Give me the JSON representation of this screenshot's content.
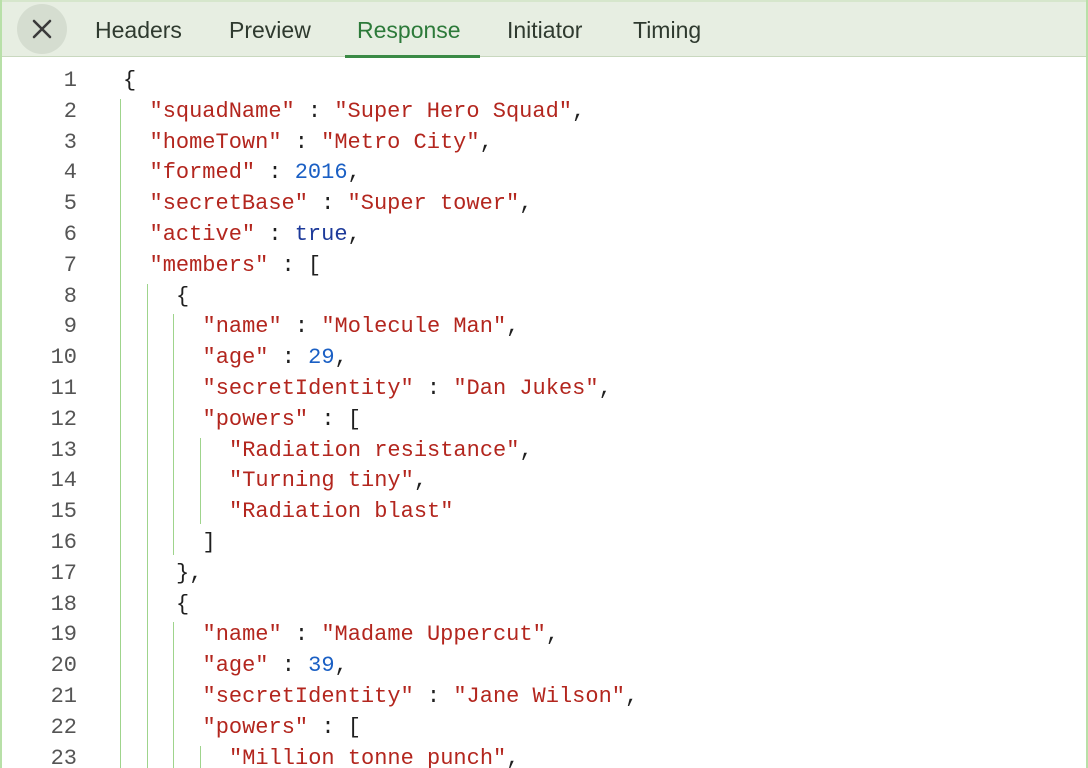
{
  "tabs": {
    "close_icon": "close-icon",
    "items": [
      {
        "label": "Headers",
        "active": false
      },
      {
        "label": "Preview",
        "active": false
      },
      {
        "label": "Response",
        "active": true
      },
      {
        "label": "Initiator",
        "active": false
      },
      {
        "label": "Timing",
        "active": false
      }
    ]
  },
  "colors": {
    "accent": "#3a8a45",
    "string": "#b3261e",
    "number": "#1a5fc4",
    "keyword": "#1d3a9a",
    "guide": "#9fd48c"
  },
  "response": {
    "lines": [
      {
        "n": "1",
        "indent": 0,
        "tokens": [
          [
            "p",
            "{"
          ]
        ]
      },
      {
        "n": "2",
        "indent": 1,
        "tokens": [
          [
            "s",
            "\"squadName\""
          ],
          [
            "p",
            " : "
          ],
          [
            "s",
            "\"Super Hero Squad\""
          ],
          [
            "p",
            ","
          ]
        ]
      },
      {
        "n": "3",
        "indent": 1,
        "tokens": [
          [
            "s",
            "\"homeTown\""
          ],
          [
            "p",
            " : "
          ],
          [
            "s",
            "\"Metro City\""
          ],
          [
            "p",
            ","
          ]
        ]
      },
      {
        "n": "4",
        "indent": 1,
        "tokens": [
          [
            "s",
            "\"formed\""
          ],
          [
            "p",
            " : "
          ],
          [
            "n",
            "2016"
          ],
          [
            "p",
            ","
          ]
        ]
      },
      {
        "n": "5",
        "indent": 1,
        "tokens": [
          [
            "s",
            "\"secretBase\""
          ],
          [
            "p",
            " : "
          ],
          [
            "s",
            "\"Super tower\""
          ],
          [
            "p",
            ","
          ]
        ]
      },
      {
        "n": "6",
        "indent": 1,
        "tokens": [
          [
            "s",
            "\"active\""
          ],
          [
            "p",
            " : "
          ],
          [
            "k",
            "true"
          ],
          [
            "p",
            ","
          ]
        ]
      },
      {
        "n": "7",
        "indent": 1,
        "tokens": [
          [
            "s",
            "\"members\""
          ],
          [
            "p",
            " : ["
          ]
        ]
      },
      {
        "n": "8",
        "indent": 2,
        "tokens": [
          [
            "p",
            "{"
          ]
        ]
      },
      {
        "n": "9",
        "indent": 3,
        "tokens": [
          [
            "s",
            "\"name\""
          ],
          [
            "p",
            " : "
          ],
          [
            "s",
            "\"Molecule Man\""
          ],
          [
            "p",
            ","
          ]
        ]
      },
      {
        "n": "10",
        "indent": 3,
        "tokens": [
          [
            "s",
            "\"age\""
          ],
          [
            "p",
            " : "
          ],
          [
            "n",
            "29"
          ],
          [
            "p",
            ","
          ]
        ]
      },
      {
        "n": "11",
        "indent": 3,
        "tokens": [
          [
            "s",
            "\"secretIdentity\""
          ],
          [
            "p",
            " : "
          ],
          [
            "s",
            "\"Dan Jukes\""
          ],
          [
            "p",
            ","
          ]
        ]
      },
      {
        "n": "12",
        "indent": 3,
        "tokens": [
          [
            "s",
            "\"powers\""
          ],
          [
            "p",
            " : ["
          ]
        ]
      },
      {
        "n": "13",
        "indent": 4,
        "tokens": [
          [
            "s",
            "\"Radiation resistance\""
          ],
          [
            "p",
            ","
          ]
        ]
      },
      {
        "n": "14",
        "indent": 4,
        "tokens": [
          [
            "s",
            "\"Turning tiny\""
          ],
          [
            "p",
            ","
          ]
        ]
      },
      {
        "n": "15",
        "indent": 4,
        "tokens": [
          [
            "s",
            "\"Radiation blast\""
          ]
        ]
      },
      {
        "n": "16",
        "indent": 3,
        "tokens": [
          [
            "p",
            "]"
          ]
        ]
      },
      {
        "n": "17",
        "indent": 2,
        "tokens": [
          [
            "p",
            "},"
          ]
        ]
      },
      {
        "n": "18",
        "indent": 2,
        "tokens": [
          [
            "p",
            "{"
          ]
        ]
      },
      {
        "n": "19",
        "indent": 3,
        "tokens": [
          [
            "s",
            "\"name\""
          ],
          [
            "p",
            " : "
          ],
          [
            "s",
            "\"Madame Uppercut\""
          ],
          [
            "p",
            ","
          ]
        ]
      },
      {
        "n": "20",
        "indent": 3,
        "tokens": [
          [
            "s",
            "\"age\""
          ],
          [
            "p",
            " : "
          ],
          [
            "n",
            "39"
          ],
          [
            "p",
            ","
          ]
        ]
      },
      {
        "n": "21",
        "indent": 3,
        "tokens": [
          [
            "s",
            "\"secretIdentity\""
          ],
          [
            "p",
            " : "
          ],
          [
            "s",
            "\"Jane Wilson\""
          ],
          [
            "p",
            ","
          ]
        ]
      },
      {
        "n": "22",
        "indent": 3,
        "tokens": [
          [
            "s",
            "\"powers\""
          ],
          [
            "p",
            " : ["
          ]
        ]
      },
      {
        "n": "23",
        "indent": 4,
        "tokens": [
          [
            "s",
            "\"Million tonne punch\""
          ],
          [
            "p",
            ","
          ]
        ]
      }
    ]
  }
}
